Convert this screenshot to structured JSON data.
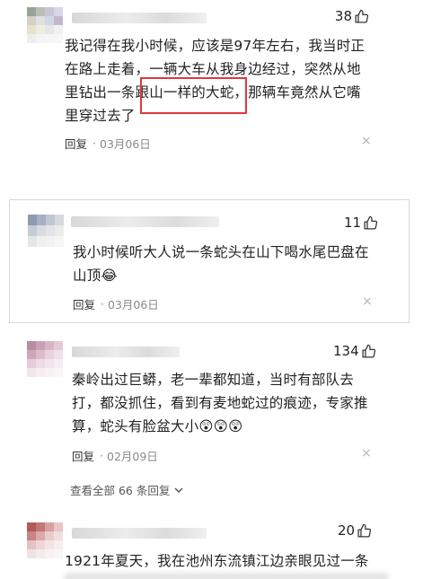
{
  "comments": [
    {
      "likes": "38",
      "text_lines": [
        "我记得在我小时候，应该是97年左右，我当时正",
        "在路上走着，一辆大车从我身边经过，突然从地",
        "里钻出一条跟山一样的大蛇，那辆车竟然从它嘴",
        "里穿过去了"
      ],
      "reply_label": "回复",
      "date": "03月06日",
      "close": "×"
    },
    {
      "likes": "11",
      "text_lines": [
        "我小时候听大人说一条蛇头在山下喝水尾巴盘在",
        "山顶😂"
      ],
      "reply_label": "回复",
      "date": "03月06日",
      "close": "×"
    },
    {
      "likes": "134",
      "text_lines": [
        "秦岭出过巨蟒，老一辈都知道，当时有部队去",
        "打，都没抓住，看到有麦地蛇过的痕迹，专家推",
        "算，蛇头有脸盆大小😲😲😲"
      ],
      "reply_label": "回复",
      "date": "02月09日",
      "close": "×",
      "view_more": "查看全部 66 条回复"
    },
    {
      "likes": "20",
      "text_lines": [
        "1921年夏天，我在池州东流镇江边亲眼见过一条"
      ]
    }
  ],
  "colors": {
    "highlight": "#e0383e",
    "meta_gray": "#8a8a8a"
  },
  "icons": {
    "like": "thumbs-up-icon",
    "close": "close-icon",
    "expand": "chevron-down-icon"
  }
}
